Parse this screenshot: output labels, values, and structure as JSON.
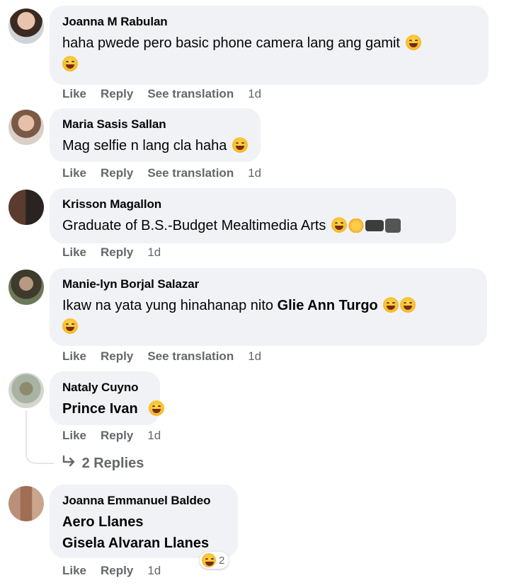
{
  "comments": [
    {
      "name": "Joanna M Rabulan",
      "text": "haha pwede pero basic phone camera lang ang gamit",
      "actions": {
        "like": "Like",
        "reply": "Reply",
        "translate": "See translation",
        "time": "1d"
      }
    },
    {
      "name": "Maria Sasis Sallan",
      "text": "Mag selfie n lang cla haha",
      "actions": {
        "like": "Like",
        "reply": "Reply",
        "translate": "See translation",
        "time": "1d"
      }
    },
    {
      "name": "Krisson Magallon",
      "text": "Graduate of B.S.-Budget Mealtimedia Arts",
      "actions": {
        "like": "Like",
        "reply": "Reply",
        "time": "1d"
      }
    },
    {
      "name": "Manie-lyn Borjal Salazar",
      "text": "Ikaw na yata yung hinahanap nito",
      "mention": "Glie Ann Turgo",
      "actions": {
        "like": "Like",
        "reply": "Reply",
        "translate": "See translation",
        "time": "1d"
      }
    },
    {
      "name": "Nataly Cuyno",
      "mention": "Prince Ivan",
      "actions": {
        "like": "Like",
        "reply": "Reply",
        "time": "1d"
      },
      "replies_label": "2 Replies"
    },
    {
      "name": "Joanna Emmanuel Baldeo",
      "mention1": "Aero Llanes",
      "mention2": "Gisela Alvaran Llanes",
      "actions": {
        "like": "Like",
        "reply": "Reply",
        "time": "1d"
      },
      "reaction_count": "2"
    }
  ],
  "icons": {
    "reply_arrow": "reply-arrow-icon",
    "emoji": "laughing-emoji-icon"
  },
  "colors": {
    "bubble": "#f0f2f5",
    "meta": "#65676b",
    "emoji": "#f7b92b"
  }
}
